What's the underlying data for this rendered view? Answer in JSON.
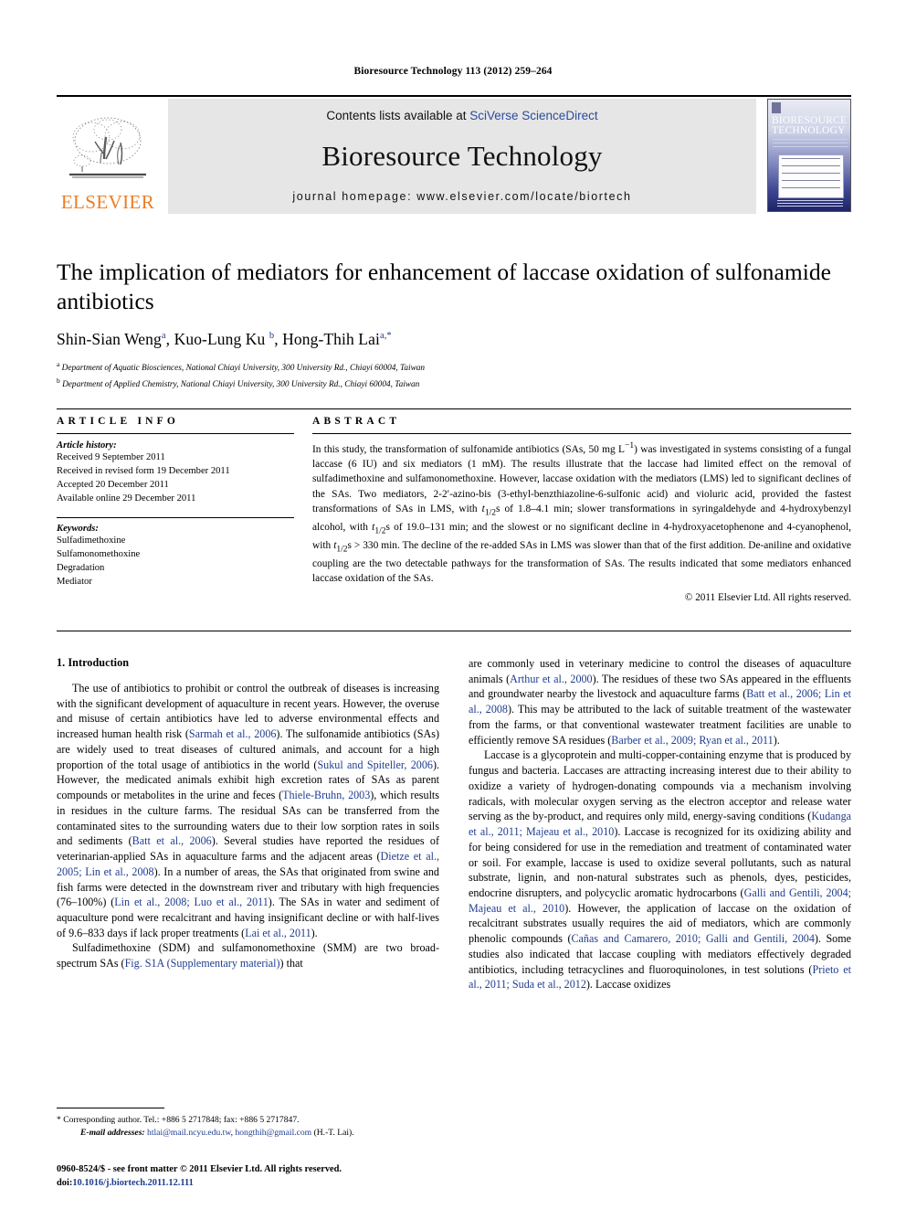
{
  "running_head": "Bioresource Technology 113 (2012) 259–264",
  "masthead": {
    "contents_prefix": "Contents lists available at ",
    "contents_link": "SciVerse ScienceDirect",
    "journal_title": "Bioresource Technology",
    "homepage": "journal homepage: www.elsevier.com/locate/biortech",
    "publisher_logo_text": "ELSEVIER",
    "cover_title_line1": "BIORESOURCE",
    "cover_title_line2": "TECHNOLOGY"
  },
  "article": {
    "title": "The implication of mediators for enhancement of laccase oxidation of sulfonamide antibiotics",
    "authors": "Shin-Sian Weng a, Kuo-Lung Ku b, Hong-Thih Lai a,*",
    "affiliation_a": "Department of Aquatic Biosciences, National Chiayi University, 300 University Rd., Chiayi 60004, Taiwan",
    "affiliation_b": "Department of Applied Chemistry, National Chiayi University, 300 University Rd., Chiayi 60004, Taiwan"
  },
  "article_info": {
    "heading": "ARTICLE INFO",
    "history_label": "Article history:",
    "history": [
      "Received 9 September 2011",
      "Received in revised form 19 December 2011",
      "Accepted 20 December 2011",
      "Available online 29 December 2011"
    ],
    "keywords_label": "Keywords:",
    "keywords": [
      "Sulfadimethoxine",
      "Sulfamonomethoxine",
      "Degradation",
      "Mediator"
    ]
  },
  "abstract": {
    "heading": "ABSTRACT",
    "text": "In this study, the transformation of sulfonamide antibiotics (SAs, 50 mg L−1) was investigated in systems consisting of a fungal laccase (6 IU) and six mediators (1 mM). The results illustrate that the laccase had limited effect on the removal of sulfadimethoxine and sulfamonomethoxine. However, laccase oxidation with the mediators (LMS) led to significant declines of the SAs. Two mediators, 2-2′-azino-bis (3-ethyl-benzthiazoline-6-sulfonic acid) and violuric acid, provided the fastest transformations of SAs in LMS, with t1/2s of 1.8–4.1 min; slower transformations in syringaldehyde and 4-hydroxybenzyl alcohol, with t1/2s of 19.0–131 min; and the slowest or no significant decline in 4-hydroxyacetophenone and 4-cyanophenol, with t1/2s > 330 min. The decline of the re-added SAs in LMS was slower than that of the first addition. De-aniline and oxidative coupling are the two detectable pathways for the transformation of SAs. The results indicated that some mediators enhanced laccase oxidation of the SAs.",
    "copyright": "© 2011 Elsevier Ltd. All rights reserved."
  },
  "body": {
    "section_heading": "1. Introduction",
    "left_paragraphs": [
      "The use of antibiotics to prohibit or control the outbreak of diseases is increasing with the significant development of aquaculture in recent years. However, the overuse and misuse of certain antibiotics have led to adverse environmental effects and increased human health risk (Sarmah et al., 2006). The sulfonamide antibiotics (SAs) are widely used to treat diseases of cultured animals, and account for a high proportion of the total usage of antibiotics in the world (Sukul and Spiteller, 2006). However, the medicated animals exhibit high excretion rates of SAs as parent compounds or metabolites in the urine and feces (Thiele-Bruhn, 2003), which results in residues in the culture farms. The residual SAs can be transferred from the contaminated sites to the surrounding waters due to their low sorption rates in soils and sediments (Batt et al., 2006). Several studies have reported the residues of veterinarian-applied SAs in aquaculture farms and the adjacent areas (Dietze et al., 2005; Lin et al., 2008). In a number of areas, the SAs that originated from swine and fish farms were detected in the downstream river and tributary with high frequencies (76–100%) (Lin et al., 2008; Luo et al., 2011). The SAs in water and sediment of aquaculture pond were recalcitrant and having insignificant decline or with half-lives of 9.6–833 days if lack proper treatments (Lai et al., 2011).",
      "Sulfadimethoxine (SDM) and sulfamonomethoxine (SMM) are two broad-spectrum SAs (Fig. S1A (Supplementary material)) that"
    ],
    "right_paragraphs": [
      "are commonly used in veterinary medicine to control the diseases of aquaculture animals (Arthur et al., 2000). The residues of these two SAs appeared in the effluents and groundwater nearby the livestock and aquaculture farms (Batt et al., 2006; Lin et al., 2008). This may be attributed to the lack of suitable treatment of the wastewater from the farms, or that conventional wastewater treatment facilities are unable to efficiently remove SA residues (Barber et al., 2009; Ryan et al., 2011).",
      "Laccase is a glycoprotein and multi-copper-containing enzyme that is produced by fungus and bacteria. Laccases are attracting increasing interest due to their ability to oxidize a variety of hydrogen-donating compounds via a mechanism involving radicals, with molecular oxygen serving as the electron acceptor and release water serving as the by-product, and requires only mild, energy-saving conditions (Kudanga et al., 2011; Majeau et al., 2010). Laccase is recognized for its oxidizing ability and for being considered for use in the remediation and treatment of contaminated water or soil. For example, laccase is used to oxidize several pollutants, such as natural substrate, lignin, and non-natural substrates such as phenols, dyes, pesticides, endocrine disrupters, and polycyclic aromatic hydrocarbons (Galli and Gentili, 2004; Majeau et al., 2010). However, the application of laccase on the oxidation of recalcitrant substrates usually requires the aid of mediators, which are commonly phenolic compounds (Cañas and Camarero, 2010; Galli and Gentili, 2004). Some studies also indicated that laccase coupling with mediators effectively degraded antibiotics, including tetracyclines and fluoroquinolones, in test solutions (Prieto et al., 2011; Suda et al., 2012). Laccase oxidizes"
    ]
  },
  "footnote": {
    "corresponding": "* Corresponding author. Tel.: +886 5 2717848; fax: +886 5 2717847.",
    "email_label": "E-mail addresses:",
    "email_1": "htlai@mail.ncyu.edu.tw",
    "email_2": "hongthih@gmail.com",
    "email_suffix": "(H.-T. Lai)."
  },
  "page_footer": {
    "issn_line": "0960-8524/$ - see front matter © 2011 Elsevier Ltd. All rights reserved.",
    "doi_prefix": "doi:",
    "doi": "10.1016/j.biortech.2011.12.111"
  },
  "colors": {
    "link_blue": "#2b4b9b",
    "ref_blue": "#1f3d8f",
    "elsevier_orange": "#ef7c22",
    "masthead_gray": "#e6e6e6"
  }
}
